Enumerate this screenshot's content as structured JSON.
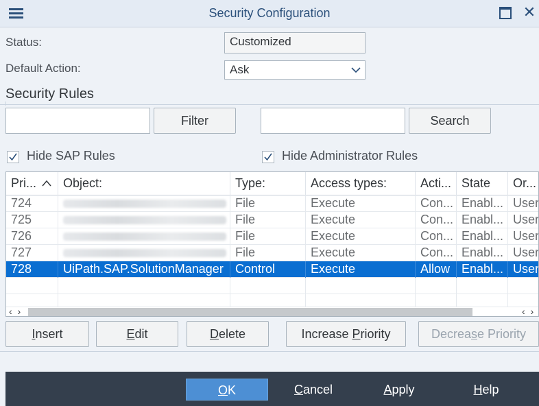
{
  "window": {
    "title": "Security Configuration"
  },
  "form": {
    "status_label": "Status:",
    "status_value": "Customized",
    "default_action_label": "Default Action:",
    "default_action_value": "Ask"
  },
  "rules": {
    "section_title": "Security Rules",
    "filter_value": "",
    "filter_button": "Filter",
    "search_value": "",
    "search_button": "Search",
    "hide_sap_label": "Hide SAP Rules",
    "hide_sap_checked": true,
    "hide_admin_label": "Hide Administrator Rules",
    "hide_admin_checked": true
  },
  "table": {
    "columns": [
      "Pri...",
      "Object:",
      "Type:",
      "Access types:",
      "Acti...",
      "State",
      "Or..."
    ],
    "sort_column": "Pri...",
    "sort_direction": "ascending",
    "rows": [
      {
        "priority": "724",
        "object": "",
        "type": "File",
        "access": "Execute",
        "action": "Con...",
        "state": "Enabl...",
        "origin": "User"
      },
      {
        "priority": "725",
        "object": "",
        "type": "File",
        "access": "Execute",
        "action": "Con...",
        "state": "Enabl...",
        "origin": "User"
      },
      {
        "priority": "726",
        "object": "",
        "type": "File",
        "access": "Execute",
        "action": "Con...",
        "state": "Enabl...",
        "origin": "User"
      },
      {
        "priority": "727",
        "object": "",
        "type": "File",
        "access": "Execute",
        "action": "Con...",
        "state": "Enabl...",
        "origin": "User"
      },
      {
        "priority": "728",
        "object": "UiPath.SAP.SolutionManager",
        "type": "Control",
        "access": "Execute",
        "action": "Allow",
        "state": "Enabl...",
        "origin": "User"
      }
    ],
    "selected_row": 4
  },
  "actions": {
    "insert_pre": "",
    "insert_u": "I",
    "insert_post": "nsert",
    "edit_pre": "",
    "edit_u": "E",
    "edit_post": "dit",
    "delete_pre": "",
    "delete_u": "D",
    "delete_post": "elete",
    "increase_pre": "Increase ",
    "increase_u": "P",
    "increase_post": "riority",
    "decrease_pre": "Decrea",
    "decrease_u": "s",
    "decrease_post": "e Priority"
  },
  "footer": {
    "ok_u": "O",
    "ok_post": "K",
    "cancel_u": "C",
    "cancel_post": "ancel",
    "apply_u": "A",
    "apply_post": "pply",
    "help_u": "H",
    "help_post": "elp"
  },
  "colors": {
    "selection": "#0a6ed1",
    "footer_bg": "#343f4d",
    "primary_button": "#4d8fd4",
    "title_text": "#2a4f7a"
  },
  "icons": [
    "hamburger-menu-icon",
    "maximize-icon",
    "close-icon",
    "chevron-down-icon",
    "checkmark-icon",
    "sort-ascending-icon",
    "scroll-left-icon",
    "scroll-right-icon"
  ]
}
